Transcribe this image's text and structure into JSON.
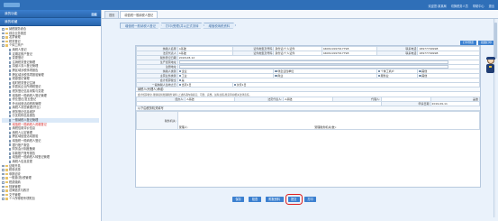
{
  "topbar": {
    "items": [
      "欢迎您:某某局",
      "切换税务人员",
      "帮助中心",
      "退出"
    ]
  },
  "sidebar": {
    "header": "我的功能",
    "header_btn": "隐藏",
    "sub_header": "我的收藏",
    "items": [
      {
        "label": "纳税服务综合",
        "type": "folder"
      },
      {
        "label": "综合业务报送",
        "type": "folder"
      },
      {
        "label": "发票管理",
        "type": "folder"
      },
      {
        "label": "税务登记",
        "type": "folder",
        "open": true
      },
      {
        "label": "个体工商户",
        "type": "folder"
      },
      {
        "label": "纳税人登记",
        "type": "doc"
      },
      {
        "label": "定期定额户登记",
        "type": "doc"
      },
      {
        "label": "变更登记",
        "type": "doc"
      },
      {
        "label": "注销税务登记管理",
        "type": "doc"
      },
      {
        "label": "扣缴义务人登记管理",
        "type": "doc"
      },
      {
        "label": "跨区域涉税事项报告",
        "type": "doc"
      },
      {
        "label": "跨区域涉税事项报验管理",
        "type": "doc"
      },
      {
        "label": "税源登记管理",
        "type": "doc"
      },
      {
        "label": "临时税务登记注销",
        "type": "doc"
      },
      {
        "label": "非居民企业所得税登记",
        "type": "doc"
      },
      {
        "label": "税务登记信息采集与变更",
        "type": "doc"
      },
      {
        "label": "增值税一般纳税人登记管理",
        "type": "doc"
      },
      {
        "label": "停业登记/复业登记",
        "type": "doc"
      },
      {
        "label": "外出经营活动税收管理",
        "type": "doc"
      },
      {
        "label": "纳税人状态管理(停业)",
        "type": "doc"
      },
      {
        "label": "税务登记信息维护",
        "type": "doc"
      },
      {
        "label": "分支机构信息报告",
        "type": "doc"
      },
      {
        "label": "一般纳税人登记管理",
        "type": "doc",
        "selected": true
      },
      {
        "label": "增值税一般纳税人资格登记",
        "type": "doc",
        "red": true
      },
      {
        "label": "纳税信用评价信息",
        "type": "doc"
      },
      {
        "label": "纳税人认定管理",
        "type": "doc"
      },
      {
        "label": "跨区域经营活动报验",
        "type": "doc"
      },
      {
        "label": "增值税一般纳税人登记",
        "type": "doc"
      },
      {
        "label": "银行账户报告",
        "type": "doc"
      },
      {
        "label": "财务会计制度备案",
        "type": "doc"
      },
      {
        "label": "存款账户账号报告",
        "type": "doc"
      },
      {
        "label": "增值税一般纳税人转登记管理",
        "type": "doc"
      },
      {
        "label": "纳税人信息变更",
        "type": "doc"
      },
      {
        "label": "证明开具",
        "type": "folder"
      },
      {
        "label": "税收优惠",
        "type": "folder"
      },
      {
        "label": "申报征收",
        "type": "folder"
      },
      {
        "label": "一般退(抵)税管理",
        "type": "folder"
      },
      {
        "label": "税费缴纳",
        "type": "folder"
      },
      {
        "label": "档案管理",
        "type": "folder"
      },
      {
        "label": "法律追责与救济",
        "type": "folder"
      },
      {
        "label": "文书管理",
        "type": "folder"
      },
      {
        "label": "个人所得税专项附加",
        "type": "folder"
      }
    ]
  },
  "main": {
    "tabs": [
      {
        "label": "首页",
        "active": false
      },
      {
        "label": "增值税一般纳税人登记",
        "active": true
      }
    ],
    "breadcrumb": [
      "增值税一般纳税人登记",
      "打印(受理)并以正式流转",
      "增值税纳税资料"
    ],
    "action_btns": [
      "打印预览",
      "批量打印"
    ],
    "form": {
      "rows": [
        [
          "纳税人名称",
          "A基础",
          "证件类型及号码",
          "身份证/个人证件",
          "440611997017798",
          "联系电话",
          "18977799998"
        ],
        [
          "法定代表人",
          "A基础",
          "证件类型及号码",
          "身份证/个人证件",
          "440611997017798",
          "联系电话",
          "18977799998"
        ],
        [
          "税务登记日期",
          "2018-08-12",
          "",
          "",
          "",
          "",
          ""
        ],
        [
          "生产经营地址",
          "",
          "",
          "",
          "",
          "",
          ""
        ],
        [
          "注册地址",
          "",
          "",
          "",
          "",
          "",
          ""
        ],
        [
          "纳税人类别",
          "",
          "",
          "",
          "",
          "",
          ""
        ],
        [
          "主营业务类别",
          "",
          "",
          "",
          "",
          "",
          ""
        ],
        [
          "会计核算健全",
          "",
          "",
          "",
          "",
          "",
          ""
        ],
        [
          "一般纳税人生效之日",
          "",
          "",
          "",
          "",
          "",
          ""
        ]
      ],
      "checks": {
        "type": [
          "企业",
          "非企业性单位",
          "个体工商户",
          "其他"
        ],
        "business": [
          "工业",
          "商业",
          "服务业",
          "其他"
        ],
        "accounting": [
          "是"
        ],
        "effective": [
          "当月1日",
          "次月1日"
        ]
      },
      "declare_title": "纳税人(代理人)承诺:",
      "declare_text": "会计核算健全,能够提供准确税务资料;上述各项内容真实、可靠、完整。如有虚假,愿意承担相关法律责任。",
      "agent_row": [
        "经办人:",
        "A基础",
        "法定代表人:",
        "A基础",
        "代理人:",
        "盖章"
      ],
      "date_label": "申请日期",
      "date_value": "2019-09-11",
      "tax_section": "以下由税务机关填写",
      "tax_opinion": "税务机关:",
      "receiver": "受理人:",
      "receiver_stamp": "受理税务机关(章):"
    },
    "bottom_btns": [
      {
        "label": "保存",
        "highlight": false
      },
      {
        "label": "检查",
        "highlight": false
      },
      {
        "label": "附报资料",
        "highlight": false
      },
      {
        "label": "提交",
        "highlight": true
      },
      {
        "label": "打印",
        "highlight": false
      }
    ]
  }
}
